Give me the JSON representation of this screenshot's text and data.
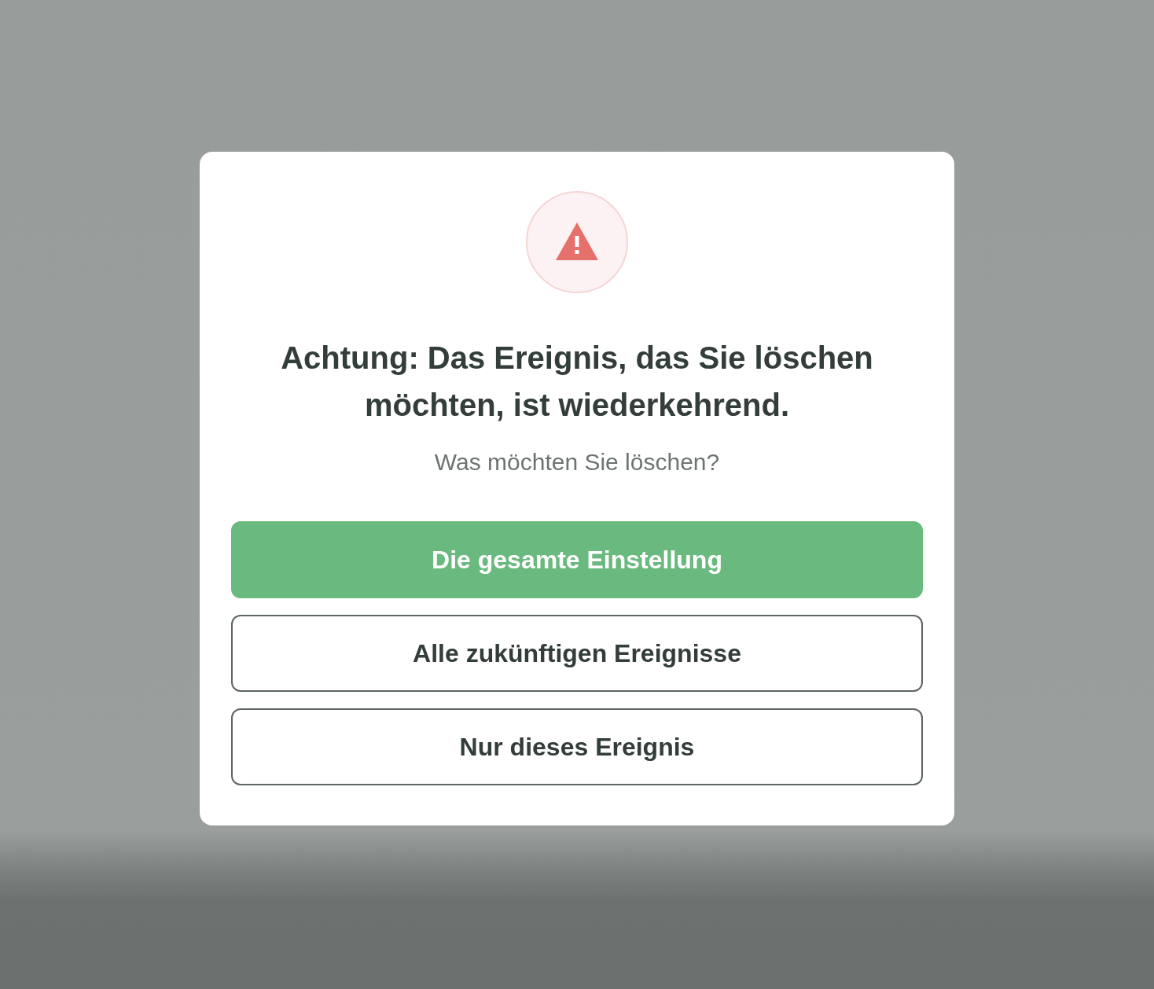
{
  "dialog": {
    "title": "Achtung: Das Ereignis, das Sie löschen möchten, ist wiederkehrend.",
    "subtitle": "Was möchten Sie löschen?",
    "options": [
      {
        "label": "Die gesamte Einstellung",
        "kind": "primary"
      },
      {
        "label": "Alle zukünftigen Ereignisse",
        "kind": "outline"
      },
      {
        "label": "Nur dieses Ereignis",
        "kind": "outline"
      }
    ]
  }
}
